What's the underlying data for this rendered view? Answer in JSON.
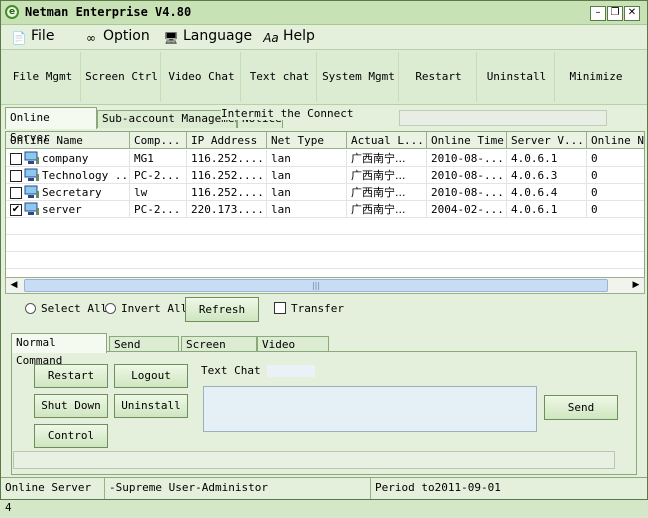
{
  "window": {
    "title": "Netman Enterprise V4.80",
    "controls": [
      "minimize-icon",
      "restore-icon",
      "close-icon"
    ]
  },
  "menu": [
    {
      "label": "File",
      "icon": "file-icon"
    },
    {
      "label": "Option",
      "icon": "glasses-icon"
    },
    {
      "label": "Language",
      "icon": "language-icon"
    },
    {
      "label": "Help",
      "icon": "help-icon"
    }
  ],
  "toolbar": [
    "File Mgmt",
    "Screen Ctrl",
    "Video Chat",
    "Text chat",
    "System Mgmt",
    "Restart",
    "Uninstall",
    "Minimize"
  ],
  "top_tabs": [
    {
      "label": "Online Server",
      "active": true
    },
    {
      "label": "Sub-account Management",
      "active": false
    },
    {
      "label": "Notice",
      "active": false
    }
  ],
  "intermit_label": "Intermit the Connect",
  "grid": {
    "columns": [
      "Online Name",
      "Comp...",
      "IP Address",
      "Net Type",
      "Actual L...",
      "Online Time",
      "Server V...",
      "Online N..."
    ],
    "rows": [
      {
        "checked": false,
        "cells": [
          "company",
          "MG1",
          "116.252....",
          "lan",
          "广西南宁...",
          "2010-08-...",
          "4.0.6.1",
          "0"
        ]
      },
      {
        "checked": false,
        "cells": [
          "Technology ...",
          "PC-2...",
          "116.252....",
          "lan",
          "广西南宁...",
          "2010-08-...",
          "4.0.6.3",
          "0"
        ]
      },
      {
        "checked": false,
        "cells": [
          "Secretary",
          "lw",
          "116.252....",
          "lan",
          "广西南宁...",
          "2010-08-...",
          "4.0.6.4",
          "0"
        ]
      },
      {
        "checked": true,
        "cells": [
          "server",
          "PC-2...",
          "220.173....",
          "lan",
          "广西南宁...",
          "2004-02-...",
          "4.0.6.1",
          "0"
        ]
      }
    ]
  },
  "options": {
    "select_all": "Select All",
    "invert_all": "Invert All",
    "refresh": "Refresh",
    "transfer": "Transfer"
  },
  "bottom_tabs": [
    {
      "label": "Normal Command",
      "active": true
    },
    {
      "label": "Send Files",
      "active": false
    },
    {
      "label": "Screen Wall",
      "active": false
    },
    {
      "label": "Video Wall",
      "active": false
    }
  ],
  "commands": {
    "restart": "Restart",
    "logout": "Logout",
    "shutdown": "Shut Down",
    "uninstall": "Uninstall",
    "control_mgmt": "Control Mgmt"
  },
  "text_chat": {
    "label": "Text Chat",
    "value": "",
    "send": "Send"
  },
  "status": {
    "online_server": "Online Server 4",
    "user": "-Supreme User-Administor",
    "period": "Period to2011-09-01"
  },
  "colors": {
    "window_bg": "#e4f0dc",
    "border": "#5a7a4a",
    "accent": "#2a6a12"
  }
}
